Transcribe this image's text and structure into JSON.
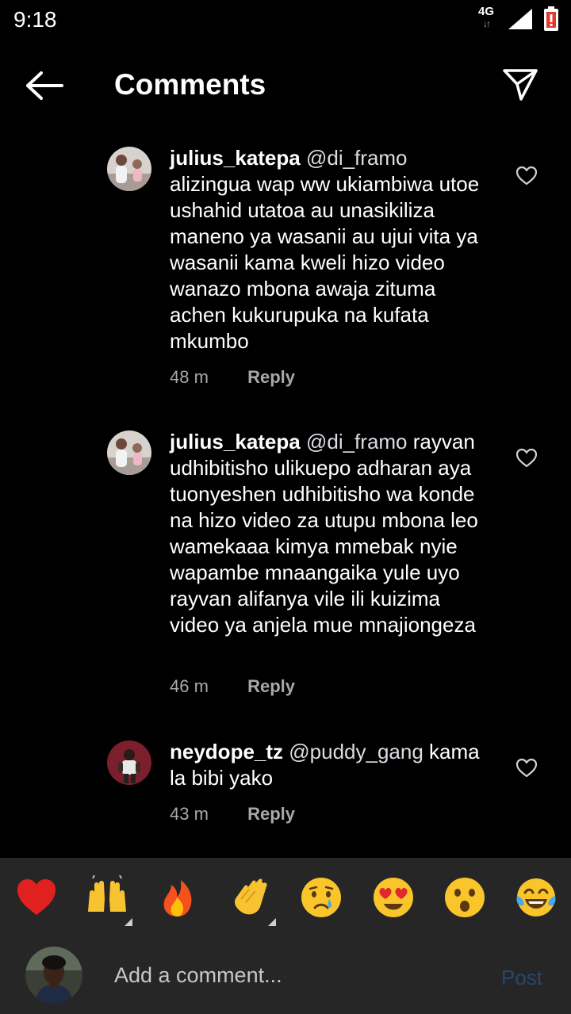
{
  "status": {
    "time": "9:18",
    "network": "4G",
    "arrows": "↓↑"
  },
  "header": {
    "title": "Comments"
  },
  "comments": [
    {
      "username": "julius_katepa",
      "mention": "@di_framo",
      "text": " alizingua wap ww ukiambiwa utoe ushahid utatoa au unasikiliza maneno ya wasanii au ujui vita ya wasanii kama kweli hizo video wanazo mbona awaja zituma achen kukurupuka na kufata mkumbo",
      "time": "48 m",
      "reply": "Reply"
    },
    {
      "username": "julius_katepa",
      "mention": "@di_framo",
      "text": " rayvan udhibitisho ulikuepo adharan aya tuonyeshen udhibitisho wa konde na hizo video za utupu mbona leo wamekaaa kimya mmebak nyie wapambe mnaangaika yule uyo rayvan alifanya vile ili kuizima video ya anjela mue mnajiongeza",
      "time": "46 m",
      "reply": "Reply"
    },
    {
      "username": "neydope_tz",
      "mention": "@puddy_gang",
      "text": " kama la bibi yako",
      "time": "43 m",
      "reply": "Reply"
    }
  ],
  "quick_reactions": [
    "red-heart",
    "raising-hands",
    "fire",
    "clapping-hands",
    "crying-face",
    "heart-eyes-face",
    "astonished-face",
    "tears-of-joy-face"
  ],
  "composer": {
    "placeholder": "Add a comment...",
    "post_label": "Post"
  },
  "colors": {
    "background": "#000000",
    "composer_bg": "#262626",
    "post_disabled": "#25486b",
    "meta_text": "#a8a8a8"
  }
}
